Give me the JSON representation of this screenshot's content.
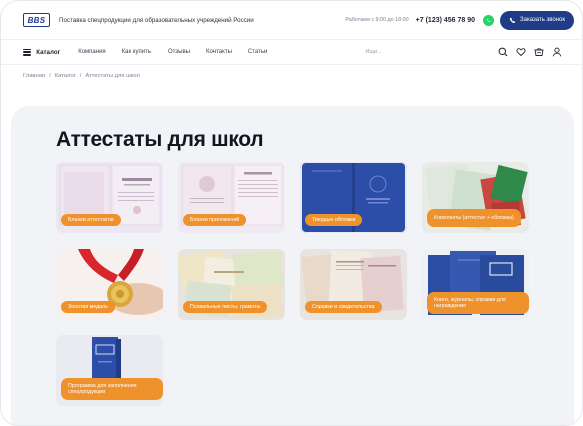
{
  "header": {
    "logo_text": "BBS",
    "tagline": "Поставка спецпродукции для образовательных учреждений России",
    "hours": "Работаем с 9:00 до 18:00",
    "phone": "+7 (123) 456 78 90",
    "whatsapp_icon": "whatsapp-icon",
    "call_button": "Заказать звонок",
    "accent": "#1f3c88"
  },
  "nav": {
    "catalog": "Каталог",
    "links": [
      "Компания",
      "Как купить",
      "Отзывы",
      "Контакты",
      "Статьи"
    ],
    "search_placeholder": "Ищи...",
    "icons": [
      "search-icon",
      "heart-icon",
      "cart-icon",
      "user-icon"
    ]
  },
  "breadcrumbs": [
    "Главная",
    "Каталог",
    "Аттестаты для школ"
  ],
  "page_title": "Аттестаты для школ",
  "label_color": "#f0922b",
  "categories": [
    "Бланки аттестатов",
    "Бланки приложений",
    "Твердые обложки",
    "Комплекты (аттестат + обложка)",
    "Золотая медаль",
    "Похвальные листы, грамоты",
    "Справки и свидетельства",
    "Книги, журналы, справки для награждения",
    "Программа для заполнения спецпродукции"
  ]
}
